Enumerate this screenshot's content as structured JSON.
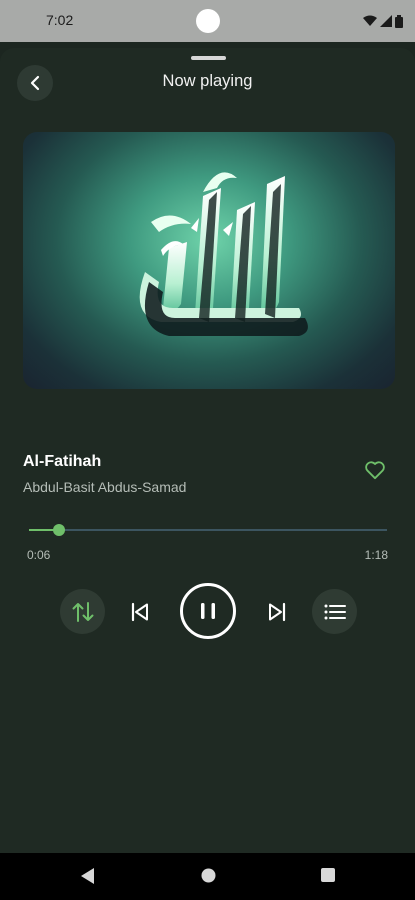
{
  "status_bar": {
    "time": "7:02"
  },
  "header": {
    "title": "Now playing"
  },
  "track": {
    "title": "Al-Fatihah",
    "artist": "Abdul-Basit Abdus-Samad",
    "favorite": false
  },
  "progress": {
    "elapsed": "0:06",
    "total": "1:18",
    "fraction": 0.085
  },
  "controls": {
    "shuffle_icon": "swap-vertical-icon",
    "prev_icon": "skip-previous-icon",
    "play_state": "playing",
    "next_icon": "skip-next-icon",
    "queue_icon": "playlist-icon"
  },
  "colors": {
    "accent": "#6fbf6a",
    "background": "#1f2a23"
  }
}
